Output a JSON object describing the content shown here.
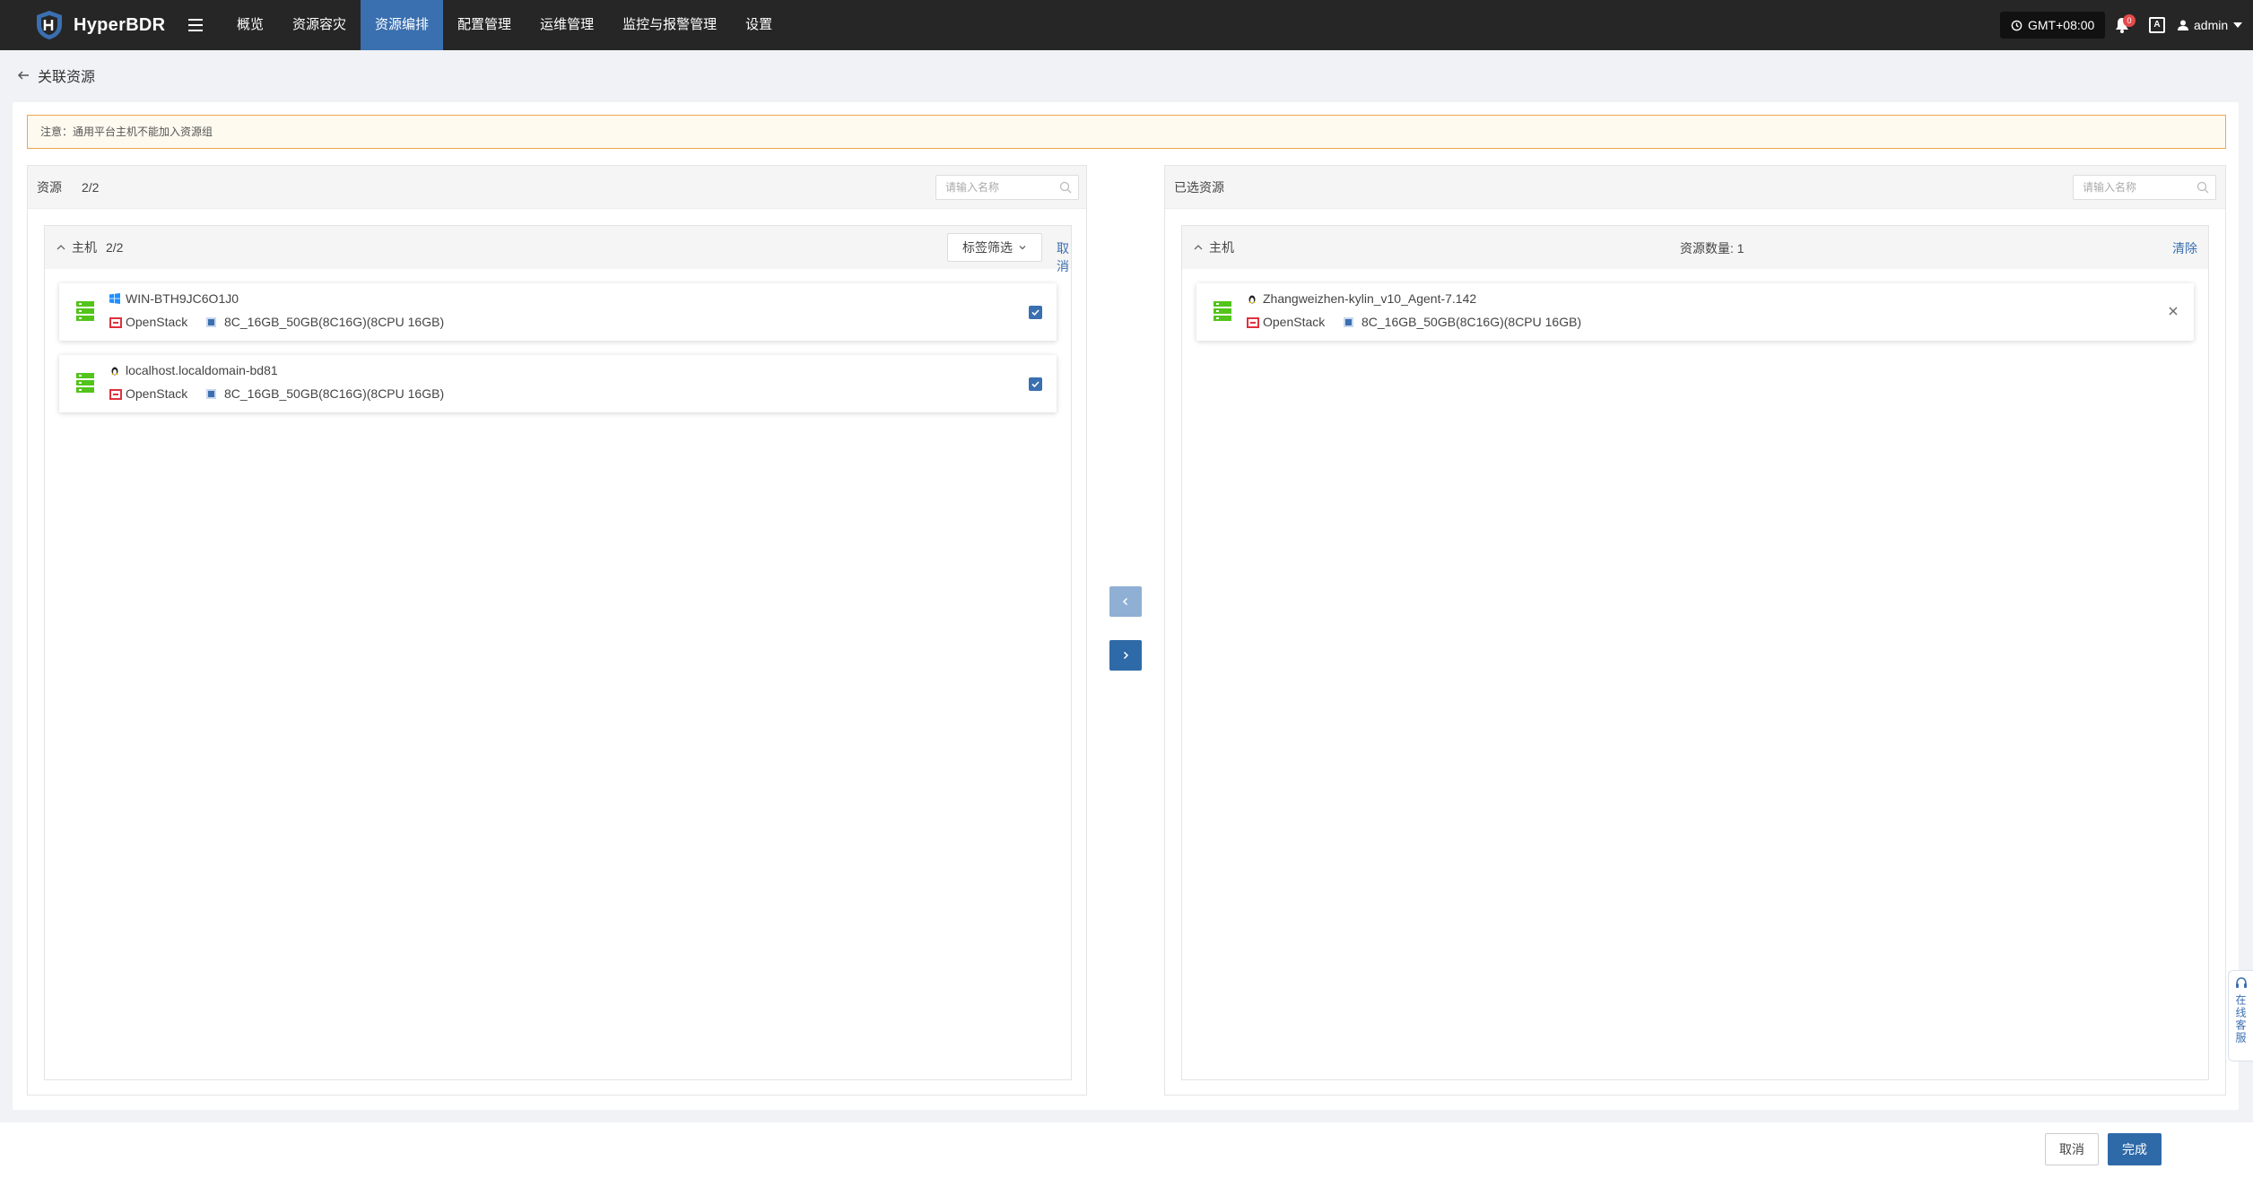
{
  "app": {
    "name": "HyperBDR"
  },
  "nav": {
    "items": [
      {
        "label": "概览"
      },
      {
        "label": "资源容灾"
      },
      {
        "label": "资源编排"
      },
      {
        "label": "配置管理"
      },
      {
        "label": "运维管理"
      },
      {
        "label": "监控与报警管理"
      },
      {
        "label": "设置"
      }
    ],
    "active_index": 2,
    "timezone": "GMT+08:00",
    "notification_count": "0",
    "lang_icon": "A",
    "user": "admin"
  },
  "page": {
    "title": "关联资源"
  },
  "notice": "注意：通用平台主机不能加入资源组",
  "left": {
    "title": "资源",
    "count": "2/2",
    "search_placeholder": "请输入名称",
    "group": {
      "title": "主机",
      "count": "2/2",
      "tag_filter": "标签筛选",
      "cancel": "取消"
    },
    "hosts": [
      {
        "name": "WIN-BTH9JC6O1J0",
        "os_icon": "windows-icon",
        "platform": "OpenStack",
        "spec": "8C_16GB_50GB(8C16G)(8CPU 16GB)",
        "checked": true
      },
      {
        "name": "localhost.localdomain-bd81",
        "os_icon": "linux-icon",
        "platform": "OpenStack",
        "spec": "8C_16GB_50GB(8C16G)(8CPU 16GB)",
        "checked": true
      }
    ]
  },
  "right": {
    "title": "已选资源",
    "search_placeholder": "请输入名称",
    "group": {
      "title": "主机",
      "resource_count": "资源数量: 1",
      "clear": "清除"
    },
    "hosts": [
      {
        "name": "Zhangweizhen-kylin_v10_Agent-7.142",
        "os_icon": "linux-icon",
        "platform": "OpenStack",
        "spec": "8C_16GB_50GB(8C16G)(8CPU 16GB)"
      }
    ]
  },
  "footer": {
    "cancel": "取消",
    "done": "完成"
  },
  "chat": {
    "label": "在线客服"
  },
  "colors": {
    "nav_bg": "#262626",
    "accent": "#3a6fb0",
    "notice_border": "#f0a54a",
    "server_green": "#52c41a",
    "openstack_red": "#e0303d"
  }
}
